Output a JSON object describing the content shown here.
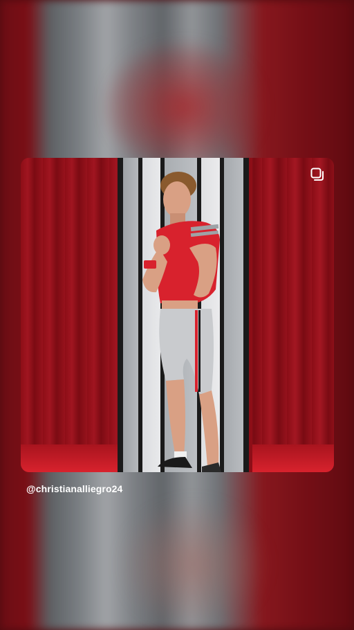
{
  "post": {
    "username": "@christianalliegro24",
    "media_type_icon": "multiple-images-icon"
  },
  "colors": {
    "scarlet": "#bb0000",
    "gray": "#b5b8bb",
    "text": "#ffffff"
  }
}
